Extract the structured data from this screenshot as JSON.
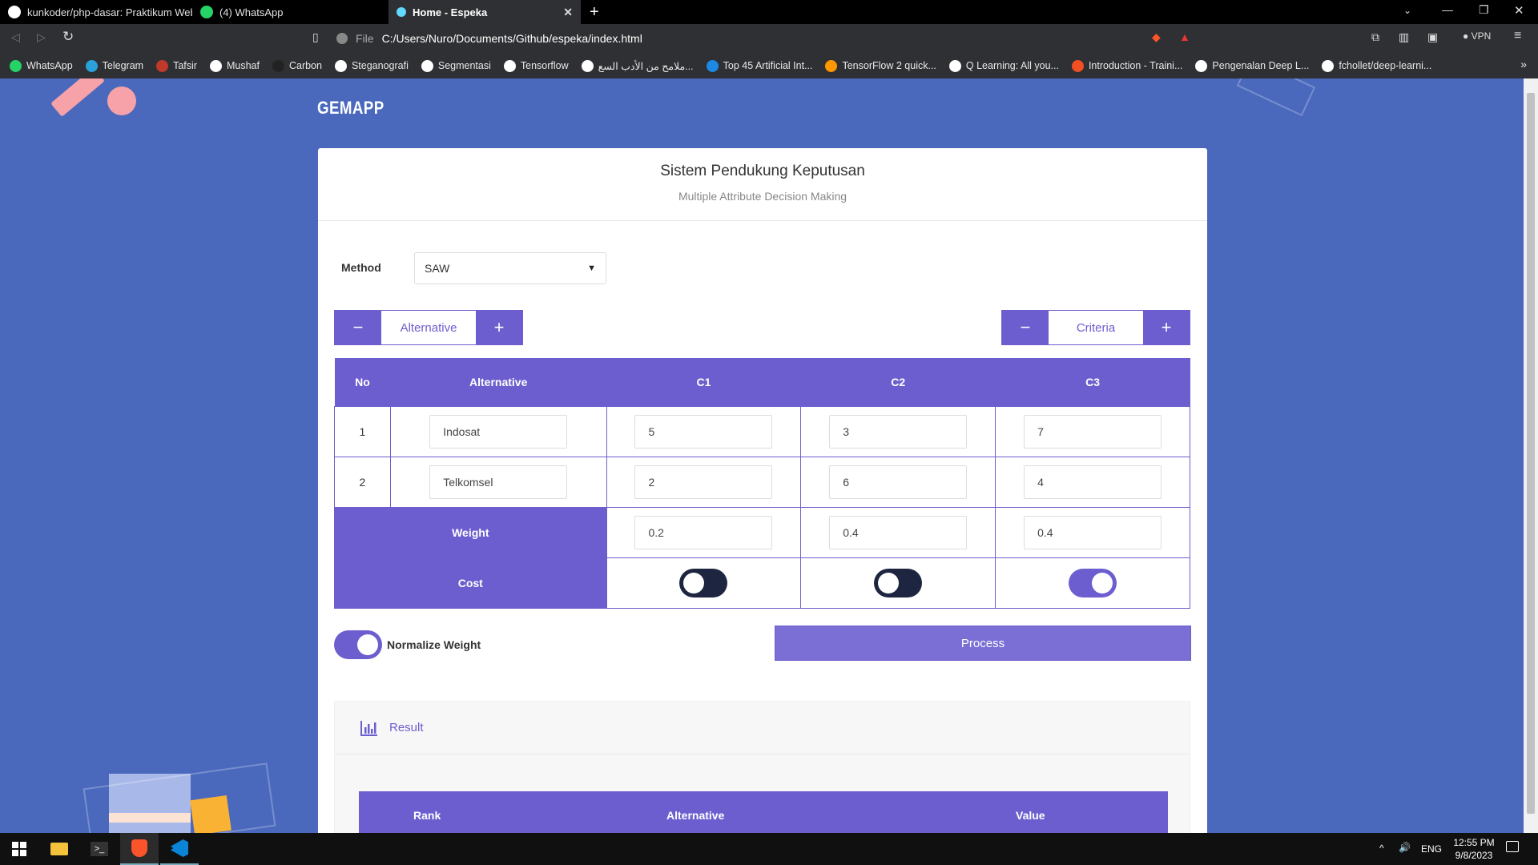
{
  "browser": {
    "tabs": [
      {
        "title": "kunkoder/php-dasar: Praktikum Web I",
        "icon": "github-icon"
      },
      {
        "title": "(4) WhatsApp",
        "icon": "whatsapp-icon"
      },
      {
        "title": "Home - Espeka",
        "icon": "react-icon"
      }
    ],
    "address": {
      "scheme": "File",
      "url": "C:/Users/Nuro/Documents/Github/espeka/index.html"
    },
    "vpn_label": "VPN",
    "bookmarks": [
      {
        "label": "WhatsApp",
        "color": "#25d366"
      },
      {
        "label": "Telegram",
        "color": "#2aa1da"
      },
      {
        "label": "Tafsir",
        "color": "#c0392b"
      },
      {
        "label": "Mushaf",
        "color": "#ffffff"
      },
      {
        "label": "Carbon",
        "color": "#222222"
      },
      {
        "label": "Steganografi",
        "color": "#ffffff"
      },
      {
        "label": "Segmentasi",
        "color": "#ffffff"
      },
      {
        "label": "Tensorflow",
        "color": "#ffffff"
      },
      {
        "label": "ملامح من الأدب السع...",
        "color": "#ffffff"
      },
      {
        "label": "Top 45 Artificial Int...",
        "color": "#1e88e5"
      },
      {
        "label": "TensorFlow 2 quick...",
        "color": "#ff9800"
      },
      {
        "label": "Q Learning: All you...",
        "color": "#ffffff"
      },
      {
        "label": "Introduction - Traini...",
        "color": "#f25022"
      },
      {
        "label": "Pengenalan Deep L...",
        "color": "#ffffff"
      },
      {
        "label": "fchollet/deep-learni...",
        "color": "#ffffff"
      }
    ]
  },
  "app": {
    "brand": "GEMAPP",
    "title": "Sistem Pendukung Keputusan",
    "subtitle": "Multiple Attribute Decision Making",
    "method_label": "Method",
    "method_value": "SAW",
    "alternative_label": "Alternative",
    "criteria_label": "Criteria",
    "minus": "−",
    "plus": "+",
    "table": {
      "headers": {
        "no": "No",
        "alternative": "Alternative",
        "c1": "C1",
        "c2": "C2",
        "c3": "C3"
      },
      "rows": [
        {
          "no": "1",
          "name": "Indosat",
          "c1": "5",
          "c2": "3",
          "c3": "7"
        },
        {
          "no": "2",
          "name": "Telkomsel",
          "c1": "2",
          "c2": "6",
          "c3": "4"
        }
      ],
      "weight_label": "Weight",
      "weights": {
        "c1": "0.2",
        "c2": "0.4",
        "c3": "0.4"
      },
      "cost_label": "Cost",
      "cost": {
        "c1": false,
        "c2": false,
        "c3": true
      }
    },
    "normalize_label": "Normalize Weight",
    "normalize_on": true,
    "process_label": "Process",
    "result": {
      "title": "Result",
      "headers": {
        "rank": "Rank",
        "alternative": "Alternative",
        "value": "Value"
      }
    }
  },
  "taskbar": {
    "lang": "ENG",
    "time": "12:55 PM",
    "date": "9/8/2023"
  },
  "colors": {
    "page_bg": "#4a69bd",
    "accent": "#6c5ecf"
  }
}
